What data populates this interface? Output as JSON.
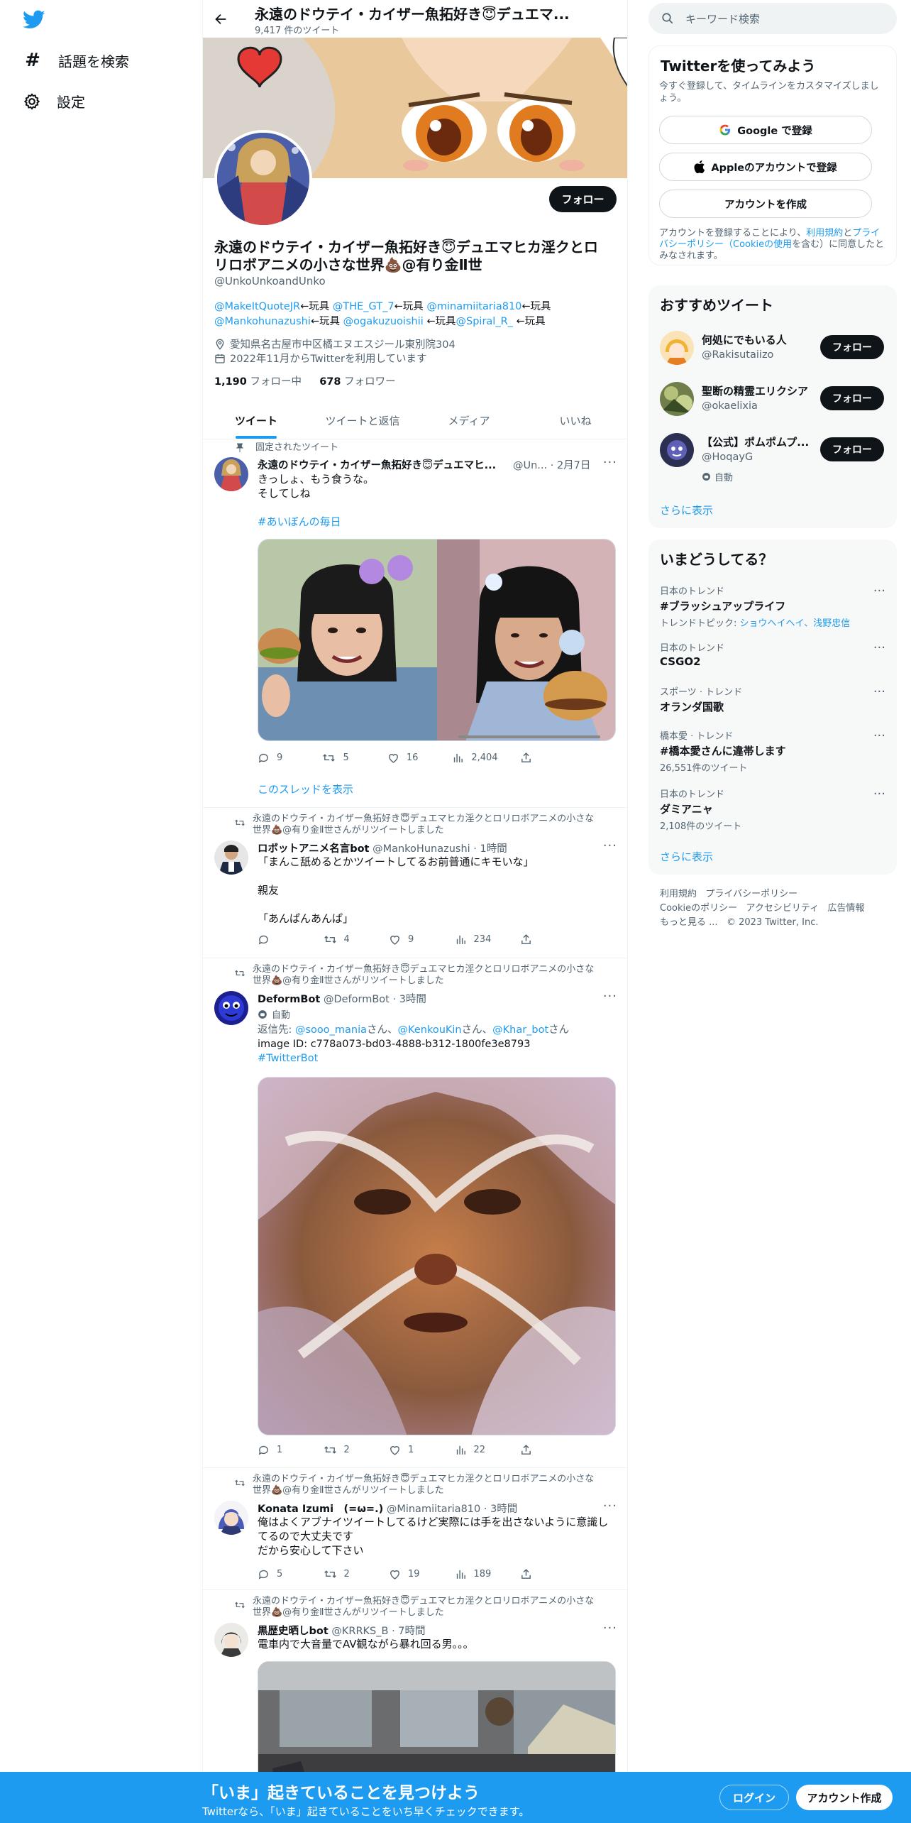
{
  "leftnav": {
    "explore_label": "話題を検索",
    "settings_label": "設定"
  },
  "header": {
    "name": "永遠のドウテイ・カイザー魚拓好き😇デュエマ...",
    "tweet_count": "9,417 件のツイート"
  },
  "profile": {
    "follow_label": "フォロー",
    "display_name": "永遠のドウテイ・カイザー魚拓好き😇デュエマヒカ淫クとロリロボアニメの小さな世界💩@有り金Ⅱ世",
    "handle": "@UnkoUnkoandUnko",
    "bio_line1": [
      {
        "t": "@MakeItQuoteJR",
        "link": true
      },
      {
        "t": "←玩具 ",
        "link": false
      },
      {
        "t": "@THE_GT_7",
        "link": true
      },
      {
        "t": "←玩具 ",
        "link": false
      },
      {
        "t": "@minamiitaria810",
        "link": true
      },
      {
        "t": "←玩具",
        "link": false
      }
    ],
    "bio_line2": [
      {
        "t": "@Mankohunazushi",
        "link": true
      },
      {
        "t": "←玩具 ",
        "link": false
      },
      {
        "t": "@ogakuzuoishii",
        "link": true
      },
      {
        "t": " ←玩具",
        "link": false
      },
      {
        "t": "@Spiral_R_",
        "link": true
      },
      {
        "t": " ←玩具",
        "link": false
      }
    ],
    "location": "愛知県名古屋市中区橘エヌエスジール東別院304",
    "joined": "2022年11月からTwitterを利用しています",
    "following_count": "1,190",
    "following_label": "フォロー中",
    "followers_count": "678",
    "followers_label": "フォロワー"
  },
  "tabs": [
    "ツイート",
    "ツイートと返信",
    "メディア",
    "いいね"
  ],
  "tweets": {
    "pinned": {
      "context": "固定されたツイート",
      "name": "永遠のドウテイ・カイザー魚拓好き😇デュエマヒ...",
      "meta": "@Un... · 2月7日",
      "line1": "きっしょ、もう食うな。",
      "line2": "そしてしね",
      "hashtag": "#あいぼんの毎日",
      "replies": "9",
      "retweets": "5",
      "likes": "16",
      "views": "2,404",
      "thread_link": "このスレッドを表示"
    },
    "rt1": {
      "context": "永遠のドウテイ・カイザー魚拓好き😇デュエマヒカ淫クとロリロボアニメの小さな世界💩@有り金Ⅱ世さんがリツイートしました",
      "name": "ロボットアニメ名言bot",
      "meta": "@MankoHunazushi · 1時間",
      "line1": "「まんこ舐めるとかツイートしてるお前普通にキモいな」",
      "line2": "親友",
      "line3": "「あんぱんあんぱ」",
      "replies": "",
      "retweets": "4",
      "likes": "9",
      "views": "234"
    },
    "rt2": {
      "context": "永遠のドウテイ・カイザー魚拓好き😇デュエマヒカ淫クとロリロボアニメの小さな世界💩@有り金Ⅱ世さんがリツイートしました",
      "name": "DeformBot",
      "meta": "@DeformBot · 3時間",
      "auto": "自動",
      "reply_prefix": "返信先: ",
      "reply_to_1": "@sooo_mania",
      "reply_sep1": "さん、",
      "reply_to_2": "@KenkouKin",
      "reply_sep2": "さん、",
      "reply_to_3": "@Khar_bot",
      "reply_suffix": "さん",
      "image_id": "image ID: c778a073-bd03-4888-b312-1800fe3e8793",
      "hashtag": "#TwitterBot",
      "replies": "1",
      "retweets": "2",
      "likes": "1",
      "views": "22"
    },
    "rt3": {
      "context": "永遠のドウテイ・カイザー魚拓好き😇デュエマヒカ淫クとロリロボアニメの小さな世界💩@有り金Ⅱ世さんがリツイートしました",
      "name": "Konata Izumi　(=ω=.)",
      "meta": "@Minamiitaria810 · 3時間",
      "line1": "俺はよくアブナイツイートしてるけど実際には手を出さないように意識してるので大丈夫です",
      "line2": "だから安心して下さい",
      "replies": "5",
      "retweets": "2",
      "likes": "19",
      "views": "189"
    },
    "rt4": {
      "context": "永遠のドウテイ・カイザー魚拓好き😇デュエマヒカ淫クとロリロボアニメの小さな世界💩@有り金Ⅱ世さんがリツイートしました",
      "name": "黒歴史晒しbot",
      "meta": "@KRRKS_B · 7時間",
      "line1": "電車内で大音量でAV観ながら暴れ回る男。。。"
    }
  },
  "right": {
    "search_placeholder": "キーワード検索",
    "signup_title": "Twitterを使ってみよう",
    "signup_sub": "今すぐ登録して、タイムラインをカスタマイズしましょう。",
    "google_btn": "Google で登録",
    "apple_btn": "Appleのアカウントで登録",
    "create_btn": "アカウントを作成",
    "terms_1": "アカウントを登録することにより、",
    "terms_link1": "利用規約",
    "terms_2": "と",
    "terms_link2": "プライバシーポリシー（Cookieの使用",
    "terms_3": "を含む）に同意したとみなされます。",
    "rec_title": "おすすめツイート",
    "rec": [
      {
        "name": "何処にでもいる人",
        "handle": "@Rakisutaiizo",
        "auto": ""
      },
      {
        "name": "聖断の精霊エリクシア",
        "handle": "@okaelixia",
        "auto": ""
      },
      {
        "name": "【公式】ポムポムプ...",
        "handle": "@HoqayG",
        "auto": "自動"
      }
    ],
    "follow_label": "フォロー",
    "show_more": "さらに表示",
    "trends_title": "いまどうしてる？",
    "trends": [
      {
        "cat": "日本のトレンド",
        "title": "#ブラッシュアップライフ",
        "sub_prefix": "トレンドトピック: ",
        "sub_link": "ショウヘイヘイ、浅野忠信",
        "sub": ""
      },
      {
        "cat": "日本のトレンド",
        "title": "CSGO2",
        "sub_prefix": "",
        "sub_link": "",
        "sub": ""
      },
      {
        "cat": "スポーツ · トレンド",
        "title": "オランダ国歌",
        "sub_prefix": "",
        "sub_link": "",
        "sub": ""
      },
      {
        "cat": "橋本愛 · トレンド",
        "title": "#橋本愛さんに違帯します",
        "sub_prefix": "",
        "sub_link": "",
        "sub": "26,551件のツイート"
      },
      {
        "cat": "日本のトレンド",
        "title": "ダミアニャ",
        "sub_prefix": "",
        "sub_link": "",
        "sub": "2,108件のツイート"
      }
    ],
    "footer": {
      "terms": "利用規約",
      "privacy": "プライバシーポリシー",
      "cookie": "Cookieのポリシー",
      "accessibility": "アクセシビリティ",
      "ads": "広告情報",
      "more": "もっと見る ...",
      "copyright": "© 2023 Twitter, Inc."
    }
  },
  "bottom": {
    "title": "「いま」起きていることを見つけよう",
    "sub": "Twitterなら、「いま」起きていることをいち早くチェックできます。",
    "login": "ログイン",
    "signup": "アカウント作成"
  },
  "colors": {
    "accent": "#1d9bf0",
    "text": "#0f1419",
    "secondary": "#536471"
  }
}
